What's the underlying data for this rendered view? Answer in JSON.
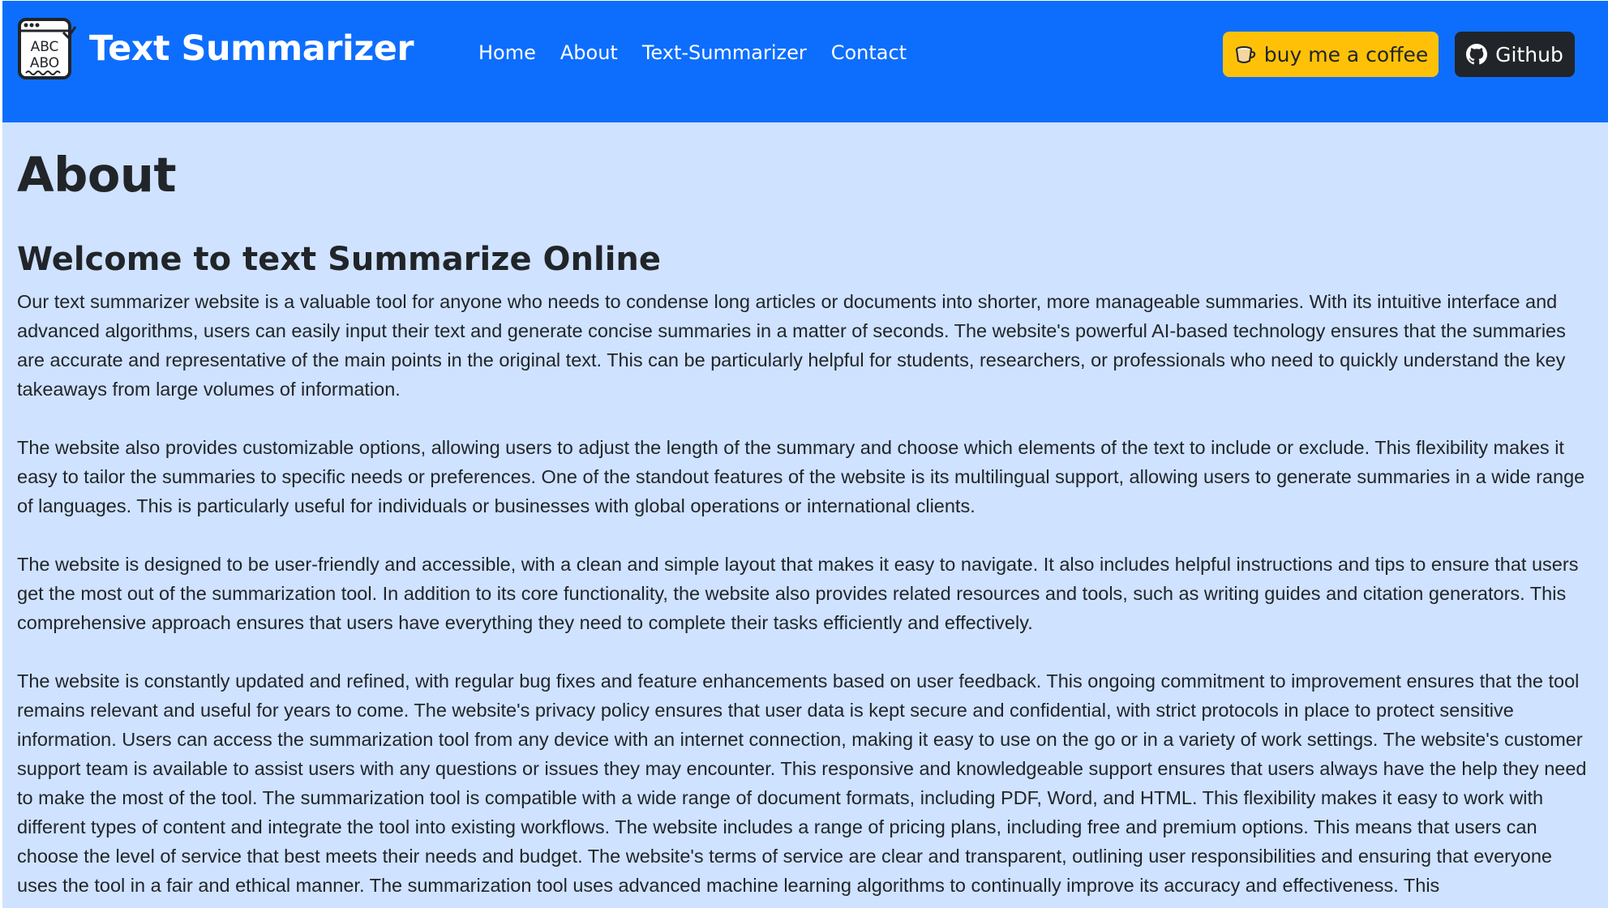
{
  "navbar": {
    "brand_title": "Text Summarizer",
    "logo_text_top": "ABC",
    "logo_text_bottom": "ABO",
    "links": [
      "Home",
      "About",
      "Text-Summarizer",
      "Contact"
    ],
    "coffee_label": "buy me a coffee",
    "github_label": "Github"
  },
  "main": {
    "title": "About",
    "subtitle": "Welcome to text Summarize Online",
    "paragraphs": [
      "Our text summarizer website is a valuable tool for anyone who needs to condense long articles or documents into shorter, more manageable summaries. With its intuitive interface and advanced algorithms, users can easily input their text and generate concise summaries in a matter of seconds. The website's powerful AI-based technology ensures that the summaries are accurate and representative of the main points in the original text. This can be particularly helpful for students, researchers, or professionals who need to quickly understand the key takeaways from large volumes of information.",
      "The website also provides customizable options, allowing users to adjust the length of the summary and choose which elements of the text to include or exclude. This flexibility makes it easy to tailor the summaries to specific needs or preferences. One of the standout features of the website is its multilingual support, allowing users to generate summaries in a wide range of languages. This is particularly useful for individuals or businesses with global operations or international clients.",
      "The website is designed to be user-friendly and accessible, with a clean and simple layout that makes it easy to navigate. It also includes helpful instructions and tips to ensure that users get the most out of the summarization tool. In addition to its core functionality, the website also provides related resources and tools, such as writing guides and citation generators. This comprehensive approach ensures that users have everything they need to complete their tasks efficiently and effectively.",
      "The website is constantly updated and refined, with regular bug fixes and feature enhancements based on user feedback. This ongoing commitment to improvement ensures that the tool remains relevant and useful for years to come. The website's privacy policy ensures that user data is kept secure and confidential, with strict protocols in place to protect sensitive information. Users can access the summarization tool from any device with an internet connection, making it easy to use on the go or in a variety of work settings. The website's customer support team is available to assist users with any questions or issues they may encounter. This responsive and knowledgeable support ensures that users always have the help they need to make the most of the tool. The summarization tool is compatible with a wide range of document formats, including PDF, Word, and HTML. This flexibility makes it easy to work with different types of content and integrate the tool into existing workflows. The website includes a range of pricing plans, including free and premium options. This means that users can choose the level of service that best meets their needs and budget. The website's terms of service are clear and transparent, outlining user responsibilities and ensuring that everyone uses the tool in a fair and ethical manner. The summarization tool uses advanced machine learning algorithms to continually improve its accuracy and effectiveness. This"
    ]
  },
  "icons": {
    "logo": "abc-document-icon",
    "coffee": "coffee-cup-icon",
    "github": "github-icon"
  },
  "colors": {
    "navbar": "#0d6efd",
    "page_background": "#cfe2ff",
    "coffee_button": "#ffc107",
    "github_button": "#212529",
    "text": "#212529"
  }
}
